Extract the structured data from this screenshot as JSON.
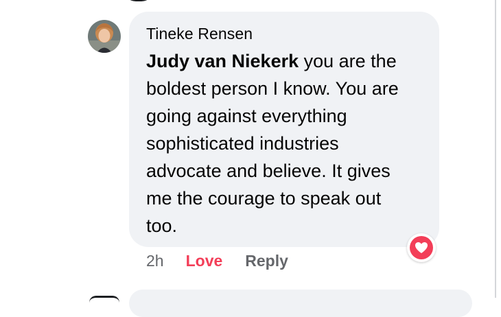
{
  "comment": {
    "author": "Tineke Rensen",
    "mention": "Judy van Niekerk",
    "text": " you are the boldest person I know. You are going against everything sophisticated industries advocate and believe. It gives me the courage to speak out too.",
    "reaction_icon": "heart-icon",
    "reaction_color": "#f33e58"
  },
  "actions": {
    "timestamp": "2h",
    "love_label": "Love",
    "reply_label": "Reply"
  },
  "colors": {
    "bubble": "#f0f2f5",
    "secondary_text": "#65676b",
    "love": "#f33e58"
  }
}
